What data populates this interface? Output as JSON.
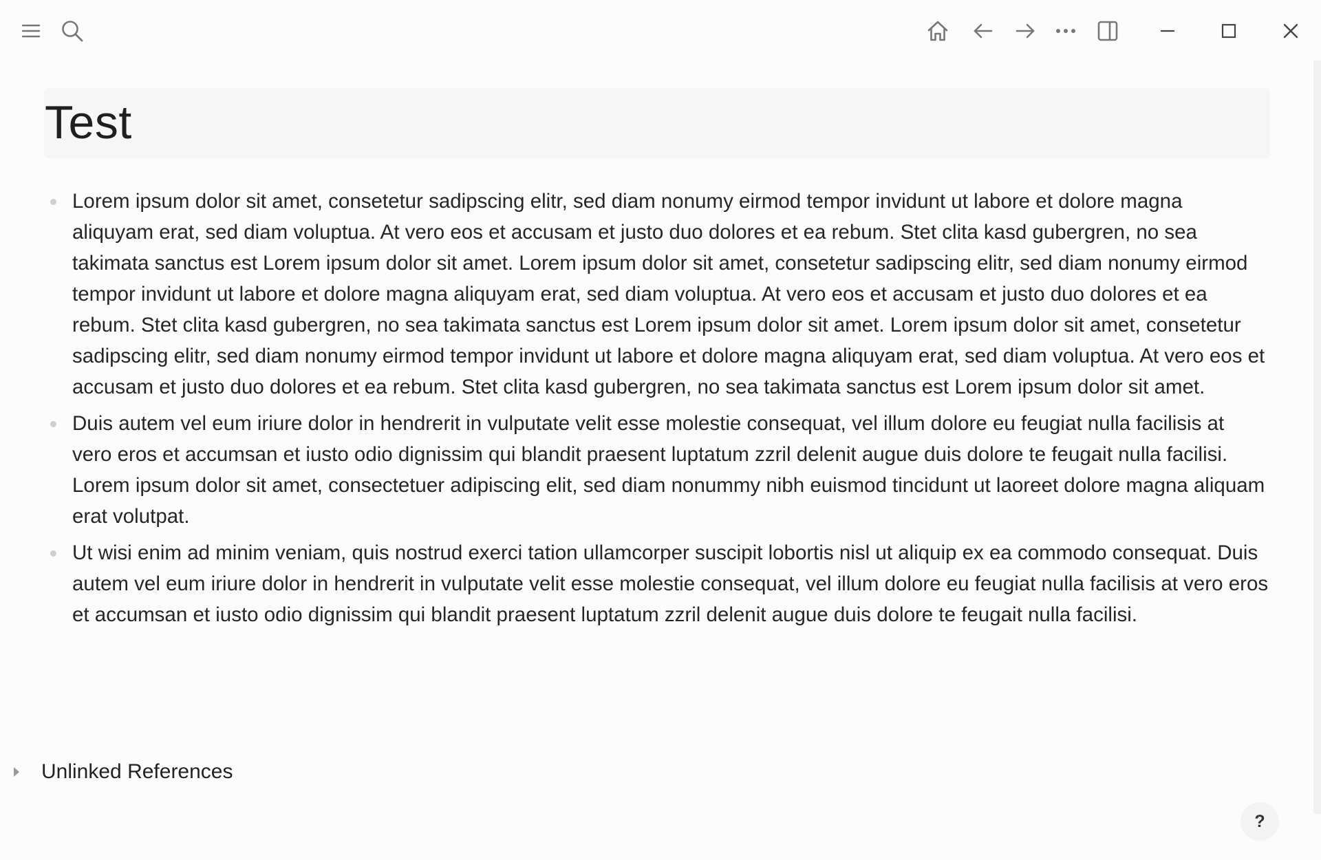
{
  "toolbar": {
    "menu_icon": "hamburger-menu-icon",
    "search_icon": "search-icon",
    "home_icon": "home-icon",
    "back_icon": "arrow-left-icon",
    "forward_icon": "arrow-right-icon",
    "more_icon": "more-horizontal-icon",
    "sidebar_icon": "toggle-right-sidebar-icon"
  },
  "window_controls": {
    "minimize_icon": "minimize-icon",
    "maximize_icon": "maximize-icon",
    "close_icon": "close-icon"
  },
  "page": {
    "title": "Test",
    "blocks": [
      {
        "text": "Lorem ipsum dolor sit amet, consetetur sadipscing elitr, sed diam nonumy eirmod tempor invidunt ut labore et dolore magna aliquyam erat, sed diam voluptua. At vero eos et accusam et justo duo dolores et ea rebum. Stet clita kasd gubergren, no sea takimata sanctus est Lorem ipsum dolor sit amet. Lorem ipsum dolor sit amet, consetetur sadipscing elitr, sed diam nonumy eirmod tempor invidunt ut labore et dolore magna aliquyam erat, sed diam voluptua. At vero eos et accusam et justo duo dolores et ea rebum. Stet clita kasd gubergren, no sea takimata sanctus est Lorem ipsum dolor sit amet. Lorem ipsum dolor sit amet, consetetur sadipscing elitr, sed diam nonumy eirmod tempor invidunt ut labore et dolore magna aliquyam erat, sed diam voluptua. At vero eos et accusam et justo duo dolores et ea rebum. Stet clita kasd gubergren, no sea takimata sanctus est Lorem ipsum dolor sit amet."
      },
      {
        "text": "Duis autem vel eum iriure dolor in hendrerit in vulputate velit esse molestie consequat, vel illum dolore eu feugiat nulla facilisis at vero eros et accumsan et iusto odio dignissim qui blandit praesent luptatum zzril delenit augue duis dolore te feugait nulla facilisi. Lorem ipsum dolor sit amet, consectetuer adipiscing elit, sed diam nonummy nibh euismod tincidunt ut laoreet dolore magna aliquam erat volutpat."
      },
      {
        "text": "Ut wisi enim ad minim veniam, quis nostrud exerci tation ullamcorper suscipit lobortis nisl ut aliquip ex ea commodo consequat. Duis autem vel eum iriure dolor in hendrerit in vulputate velit esse molestie consequat, vel illum dolore eu feugiat nulla facilisis at vero eros et accumsan et iusto odio dignissim qui blandit praesent luptatum zzril delenit augue duis dolore te feugait nulla facilisi."
      }
    ]
  },
  "references": {
    "unlinked_label": "Unlinked References",
    "caret_icon": "caret-right-icon"
  },
  "help": {
    "label": "?"
  }
}
